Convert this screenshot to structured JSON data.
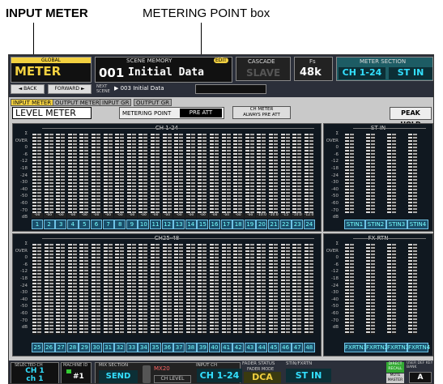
{
  "callouts": {
    "input_meter": "INPUT METER",
    "metering_point_box": "METERING POINT box"
  },
  "header": {
    "global_label": "GLOBAL",
    "app_title": "METER",
    "back_label": "◄ BACK",
    "forward_label": "FORWARD ►",
    "scene_memory_label": "SCENE MEMORY",
    "edit_badge": "EDIT",
    "scene_number": "001",
    "scene_name": "Initial Data",
    "next_label": "NEXT SCENE",
    "next_scene": "▶ 003 Initial Data",
    "cascade_label": "CASCADE",
    "cascade_value": "SLAVE",
    "fs_label": "Fs",
    "fs_value": "48k",
    "meter_section_label": "METER SECTION",
    "meter_section_a": "CH 1-24",
    "meter_section_b": "ST IN"
  },
  "tabs": [
    "INPUT METER",
    "OUTPUT METER",
    "INPUT GR",
    "OUTPUT GR"
  ],
  "toolbar": {
    "level_meter": "LEVEL METER",
    "metering_point_label": "METERING POINT",
    "metering_point_value": "PRE ATT",
    "ch_meter_btn_line1": "CH METER",
    "ch_meter_btn_line2": "ALWAYS PRE ATT",
    "peak_hold": "PEAK HOLD"
  },
  "panels": {
    "ch1_24_title": "CH 1-24",
    "ch25_48_title": "CH25-48",
    "st_in_title": "ST IN",
    "fx_rtn_title": "FX RTN"
  },
  "scale_labels": [
    "Σ",
    "OVER",
    "0",
    "-6",
    "-12",
    "-18",
    "-24",
    "-30",
    "-40",
    "-50",
    "-60",
    "-70",
    "dB"
  ],
  "ch1_24_peaks": [
    "-oo",
    "-oo",
    "-oo",
    "-oo",
    "-oo",
    "-oo",
    "-oo",
    "-oo",
    "-oo",
    "-oo",
    "-oo",
    "-oo",
    "-oo",
    "-oo",
    "-oo",
    "-oo",
    "-oo",
    "-oo",
    "-oo",
    "-10.0",
    "-10.0",
    "-15",
    "-10.0",
    "-12.0"
  ],
  "ch1_24_channels": [
    "1",
    "2",
    "3",
    "4",
    "5",
    "6",
    "7",
    "8",
    "9",
    "10",
    "11",
    "12",
    "13",
    "14",
    "15",
    "16",
    "17",
    "18",
    "19",
    "20",
    "21",
    "22",
    "23",
    "24"
  ],
  "ch25_48_channels": [
    "25",
    "26",
    "27",
    "28",
    "29",
    "30",
    "31",
    "32",
    "33",
    "34",
    "35",
    "36",
    "37",
    "38",
    "39",
    "40",
    "41",
    "42",
    "43",
    "44",
    "45",
    "46",
    "47",
    "48"
  ],
  "st_in_channels": [
    "STIN1",
    "STIN2",
    "STIN3",
    "STIN4"
  ],
  "fx_rtn_channels": [
    "FXRTN1",
    "FXRTN2",
    "FXRTN3",
    "FXRTN4"
  ],
  "footer": {
    "selected_ch_label": "SELECTED CH",
    "selected_ch_line1": "CH 1",
    "selected_ch_line2": "ch 1",
    "machine_id_label": "MACHINE ID",
    "machine_id_value": "#1",
    "mix_section_label": "MIX SECTION",
    "send_label": "SEND",
    "mx_label": "MX20",
    "ch_level_label": "CH LEVEL",
    "input_ch_label": "INPUT CH",
    "input_ch_value": "CH 1-24",
    "fader_status_label": "FADER STATUS",
    "fader_mode_label": "FADER MODE",
    "fader_mode_value": "DCA",
    "stin_fxrtn_label": "STIN/FXRTN",
    "stin_value": "ST IN",
    "direct_recall_label": "DIRECT RECALL",
    "mute_master_label": "MUTE MASTER",
    "user_def_label": "USER DEF KEY BANK",
    "user_def_value": "A"
  },
  "colors": {
    "accent_yellow": "#f2d040",
    "cyan": "#33e0ff",
    "panel_bg": "#101820"
  }
}
